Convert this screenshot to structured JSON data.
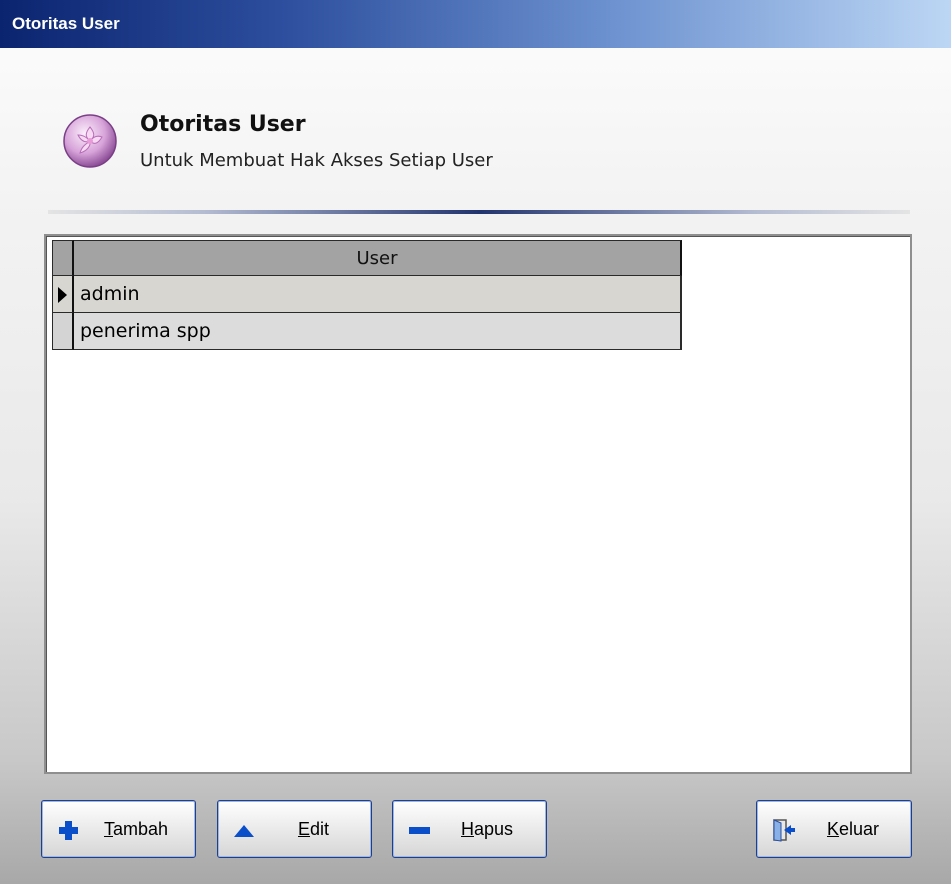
{
  "window": {
    "title": "Otoritas User"
  },
  "header": {
    "icon": "flower-logo-icon",
    "title": "Otoritas User",
    "subtitle": "Untuk Membuat Hak Akses Setiap User"
  },
  "grid": {
    "columns": [
      "User"
    ],
    "rows": [
      {
        "user": "admin",
        "selected": true
      },
      {
        "user": "penerima spp",
        "selected": false
      }
    ]
  },
  "buttons": {
    "tambah": {
      "label": "Tambah",
      "icon": "plus-icon"
    },
    "edit": {
      "label": "Edit",
      "icon": "triangle-up-icon"
    },
    "hapus": {
      "label": "Hapus",
      "icon": "minus-icon"
    },
    "keluar": {
      "label": "Keluar",
      "icon": "exit-door-icon"
    }
  },
  "colors": {
    "accent": "#0a4ec9",
    "titlebar": "#0b2470",
    "grid_header": "#a3a3a3",
    "row_selected": "#d8d6d1",
    "row_normal": "#dcdcdc"
  }
}
